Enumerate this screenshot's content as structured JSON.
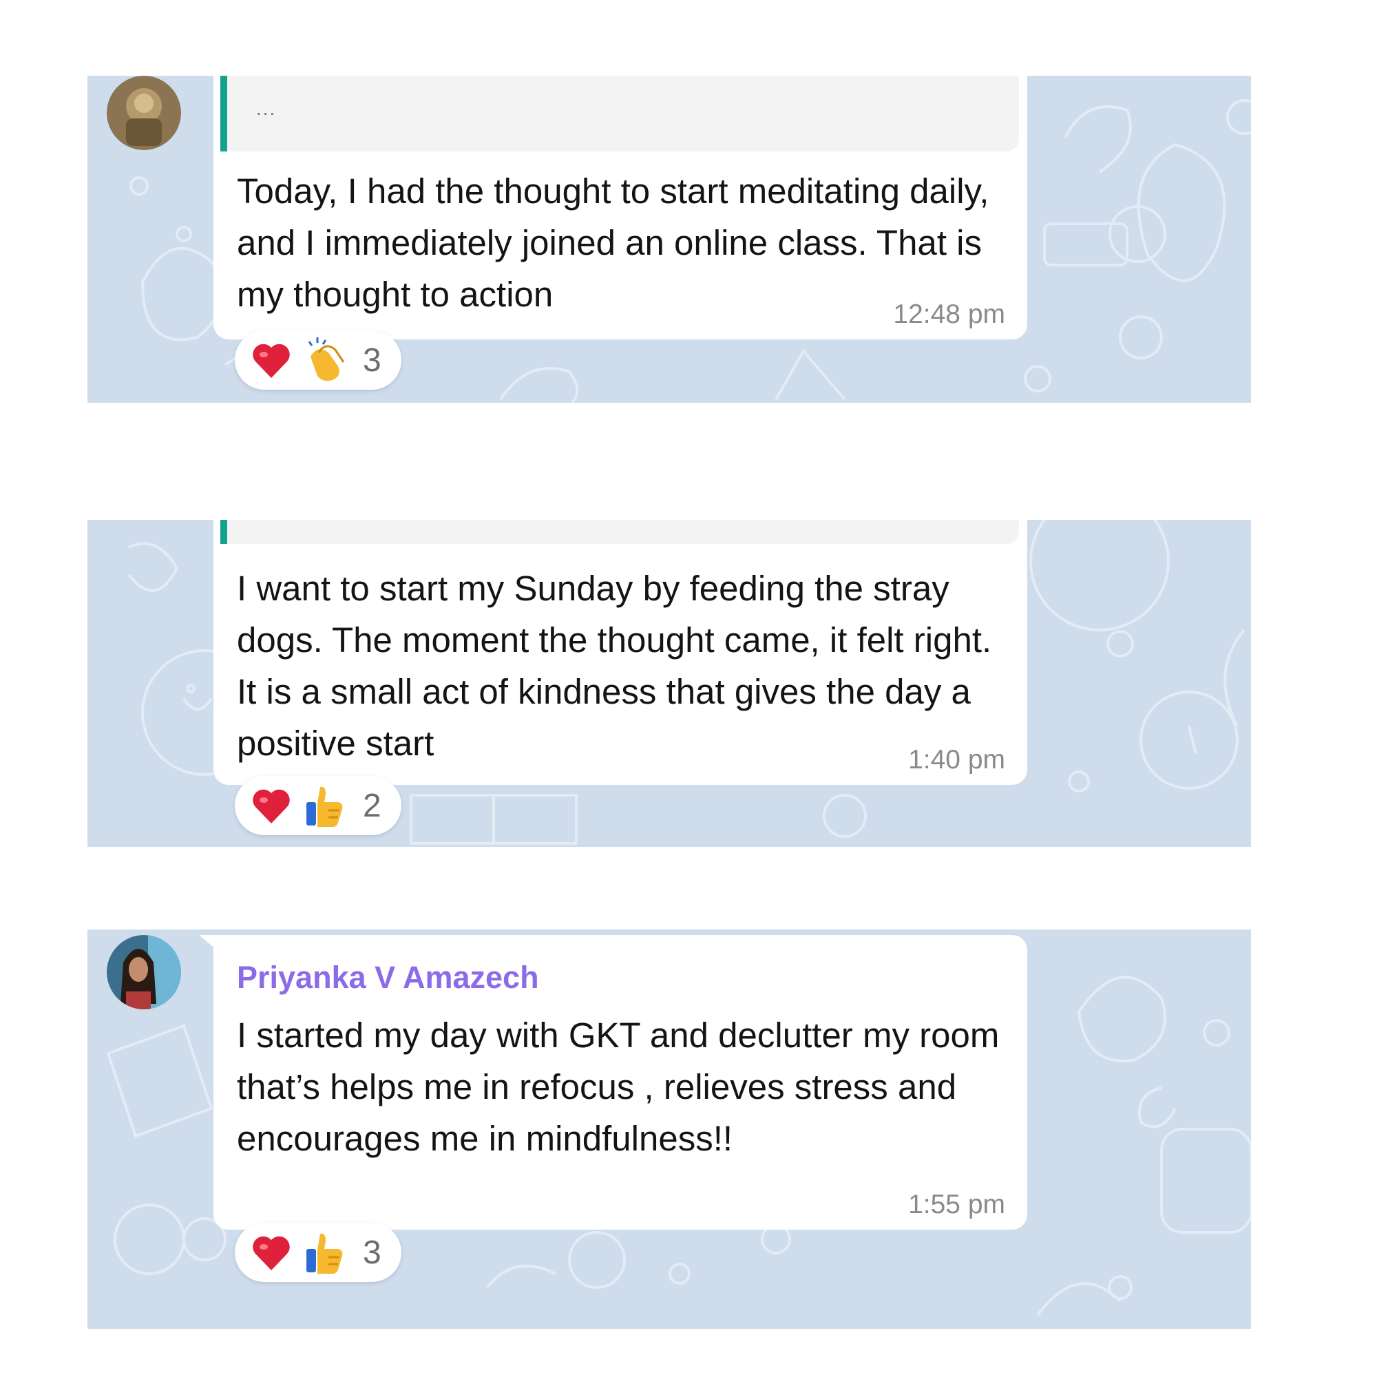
{
  "colors": {
    "chat_background": "#cfdcec",
    "bubble": "#ffffff",
    "reply_accent": "#14a38a",
    "sender_name": "#8b6be8",
    "timestamp": "#8a8a8a"
  },
  "messages": [
    {
      "reply_preview": "...",
      "text": "Today, I had the thought to start meditating daily, and I immediately joined an online class. That is my thought to action",
      "time": "12:48 pm",
      "reactions": {
        "icons": [
          "heart-icon",
          "clapping-hands-icon"
        ],
        "count": "3"
      }
    },
    {
      "text": "I want to start my Sunday by feeding the stray dogs. The moment the thought came, it felt right. It is a small act of kindness that gives the day a positive start",
      "time": "1:40 pm",
      "reactions": {
        "icons": [
          "heart-icon",
          "thumbs-up-icon"
        ],
        "count": "2"
      }
    },
    {
      "sender": "Priyanka V Amazech",
      "text": "I started my day with GKT and declutter my room that’s helps me in refocus , relieves stress and encourages me in mindfulness!!",
      "time": "1:55 pm",
      "reactions": {
        "icons": [
          "heart-icon",
          "thumbs-up-icon"
        ],
        "count": "3"
      }
    }
  ]
}
